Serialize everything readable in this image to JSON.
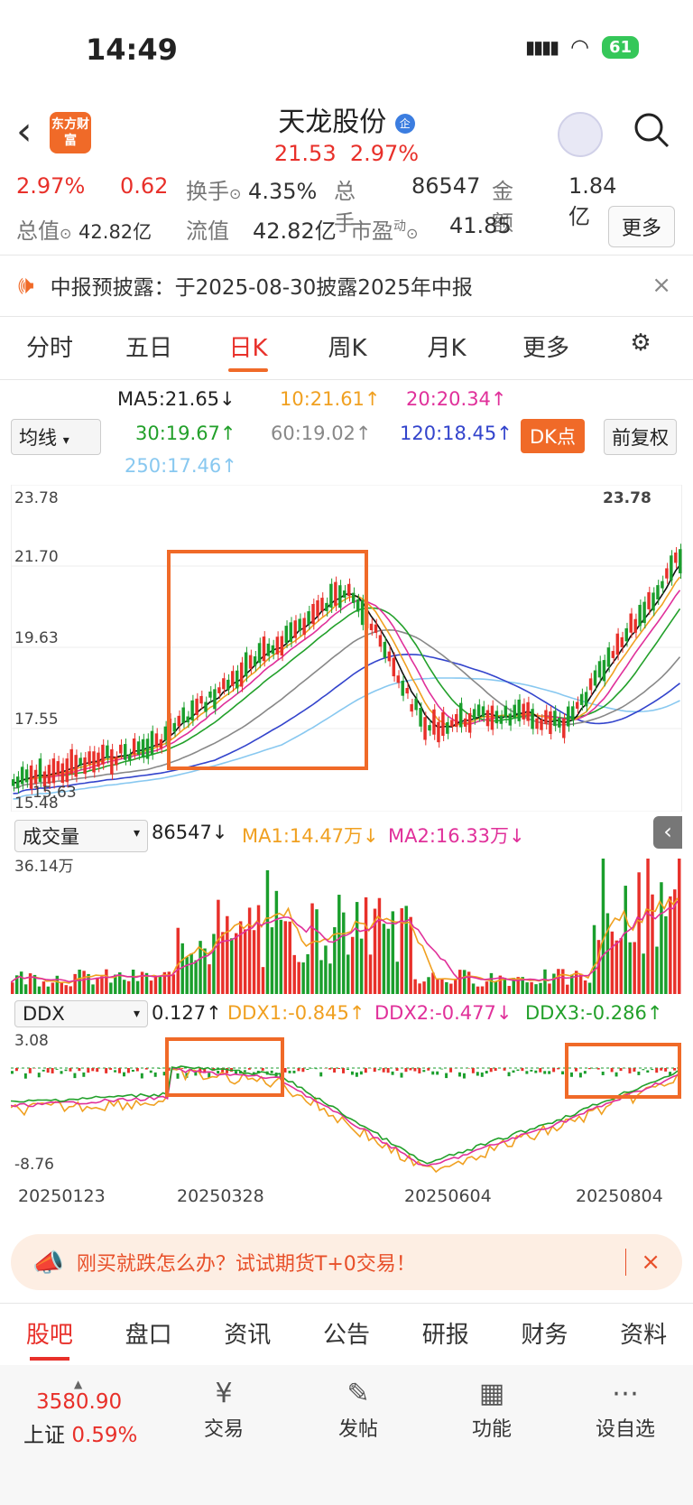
{
  "status": {
    "time": "14:49",
    "battery": "61"
  },
  "header": {
    "logo": "东方财富",
    "title": "天龙股份",
    "badge": "企",
    "price": "21.53",
    "change_pct": "2.97%"
  },
  "info": {
    "pct": "2.97%",
    "chg": "0.62",
    "turnover_label": "换手",
    "turnover": "4.35%",
    "volume_label": "总手",
    "volume": "86547",
    "amount_label": "金额",
    "amount": "1.84亿",
    "total_cap_label": "总值",
    "total_cap": "42.82亿",
    "float_cap_label": "流值",
    "float_cap": "42.82亿",
    "pe_label": "市盈",
    "pe_sup": "动",
    "pe": "41.85",
    "more": "更多"
  },
  "notice": {
    "text": "中报预披露：于2025-08-30披露2025年中报",
    "close": "×"
  },
  "tabs": [
    "分时",
    "五日",
    "日K",
    "周K",
    "月K",
    "更多"
  ],
  "ma": {
    "selector": "均线",
    "ma5": "MA5:21.65↓",
    "ma10": "10:21.61↑",
    "ma20": "20:20.34↑",
    "ma30": "30:19.67↑",
    "ma60": "60:19.02↑",
    "ma120": "120:18.45↑",
    "ma250": "250:17.46↑",
    "dk_btn": "DK点",
    "fq_btn": "前复权"
  },
  "colors": {
    "ma5": "#111111",
    "ma10": "#f0a020",
    "ma20": "#e0309a",
    "ma30": "#22a02a",
    "ma60": "#888888",
    "ma120": "#3344cc",
    "ma250": "#88c8f0",
    "up": "#e8302a",
    "down": "#1a9e2c",
    "accent": "#f06a28"
  },
  "kline": {
    "y_labels": [
      "23.78",
      "21.70",
      "19.63",
      "17.55",
      "15.48"
    ],
    "high_label": "23.78",
    "low_label": "15.63"
  },
  "volume": {
    "selector": "成交量",
    "value": "86547↓",
    "ma1": "MA1:14.47万↓",
    "ma2": "MA2:16.33万↓",
    "max_label": "36.14万"
  },
  "ddx": {
    "selector": "DDX",
    "value": "0.127↑",
    "ddx1": "DDX1:-0.845↑",
    "ddx2": "DDX2:-0.477↓",
    "ddx3": "DDX3:-0.286↑",
    "top_label": "3.08",
    "bottom_label": "-8.76"
  },
  "x_dates": [
    "20250123",
    "20250328",
    "20250604",
    "20250804"
  ],
  "ad": {
    "text": "刚买就跌怎么办？试试期货T+0交易！",
    "close": "×"
  },
  "bottom_tabs": [
    "股吧",
    "盘口",
    "资讯",
    "公告",
    "研报",
    "财务",
    "资料"
  ],
  "index": {
    "value": "3580.90",
    "name": "上证",
    "pct": "0.59%"
  },
  "tools": [
    {
      "icon": "¥",
      "label": "交易"
    },
    {
      "icon": "✎",
      "label": "发帖"
    },
    {
      "icon": "▦",
      "label": "功能"
    },
    {
      "icon": "⋯",
      "label": "设自选"
    }
  ]
}
